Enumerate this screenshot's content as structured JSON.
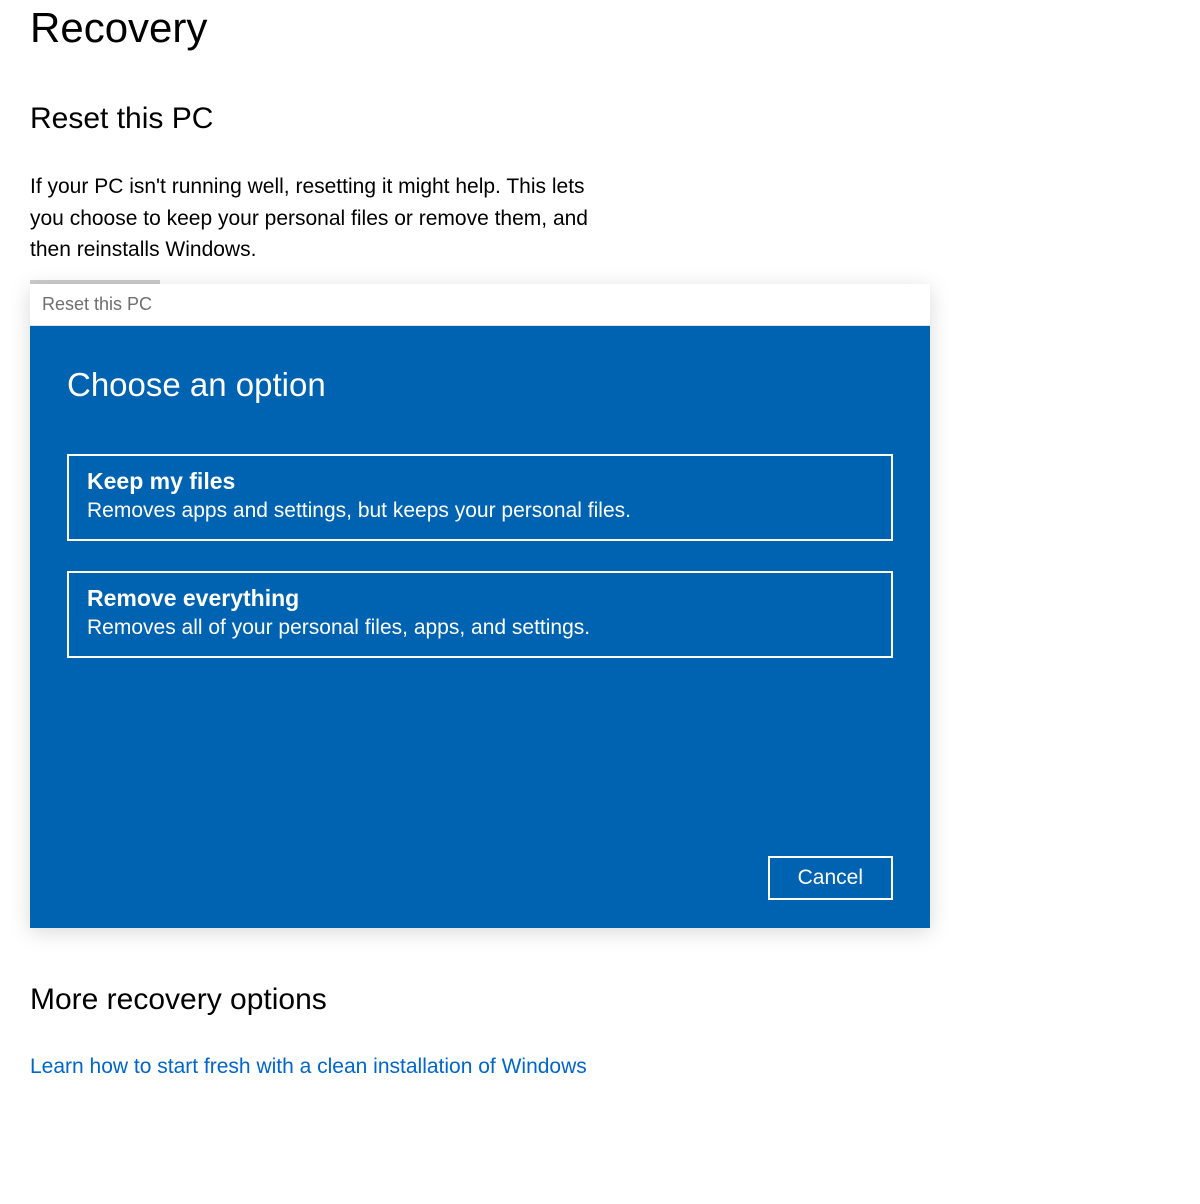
{
  "page_title": "Recovery",
  "reset_section": {
    "title": "Reset this PC",
    "description": "If your PC isn't running well, resetting it might help. This lets you choose to keep your personal files or remove them, and then reinstalls Windows."
  },
  "dialog": {
    "window_title": "Reset this PC",
    "heading": "Choose an option",
    "options": [
      {
        "title": "Keep my files",
        "description": "Removes apps and settings, but keeps your personal files."
      },
      {
        "title": "Remove everything",
        "description": "Removes all of your personal files, apps, and settings."
      }
    ],
    "cancel_label": "Cancel"
  },
  "more_section": {
    "title": "More recovery options",
    "link_text": "Learn how to start fresh with a clean installation of Windows"
  },
  "colors": {
    "dialog_bg": "#0063b1",
    "link": "#0066cc"
  }
}
